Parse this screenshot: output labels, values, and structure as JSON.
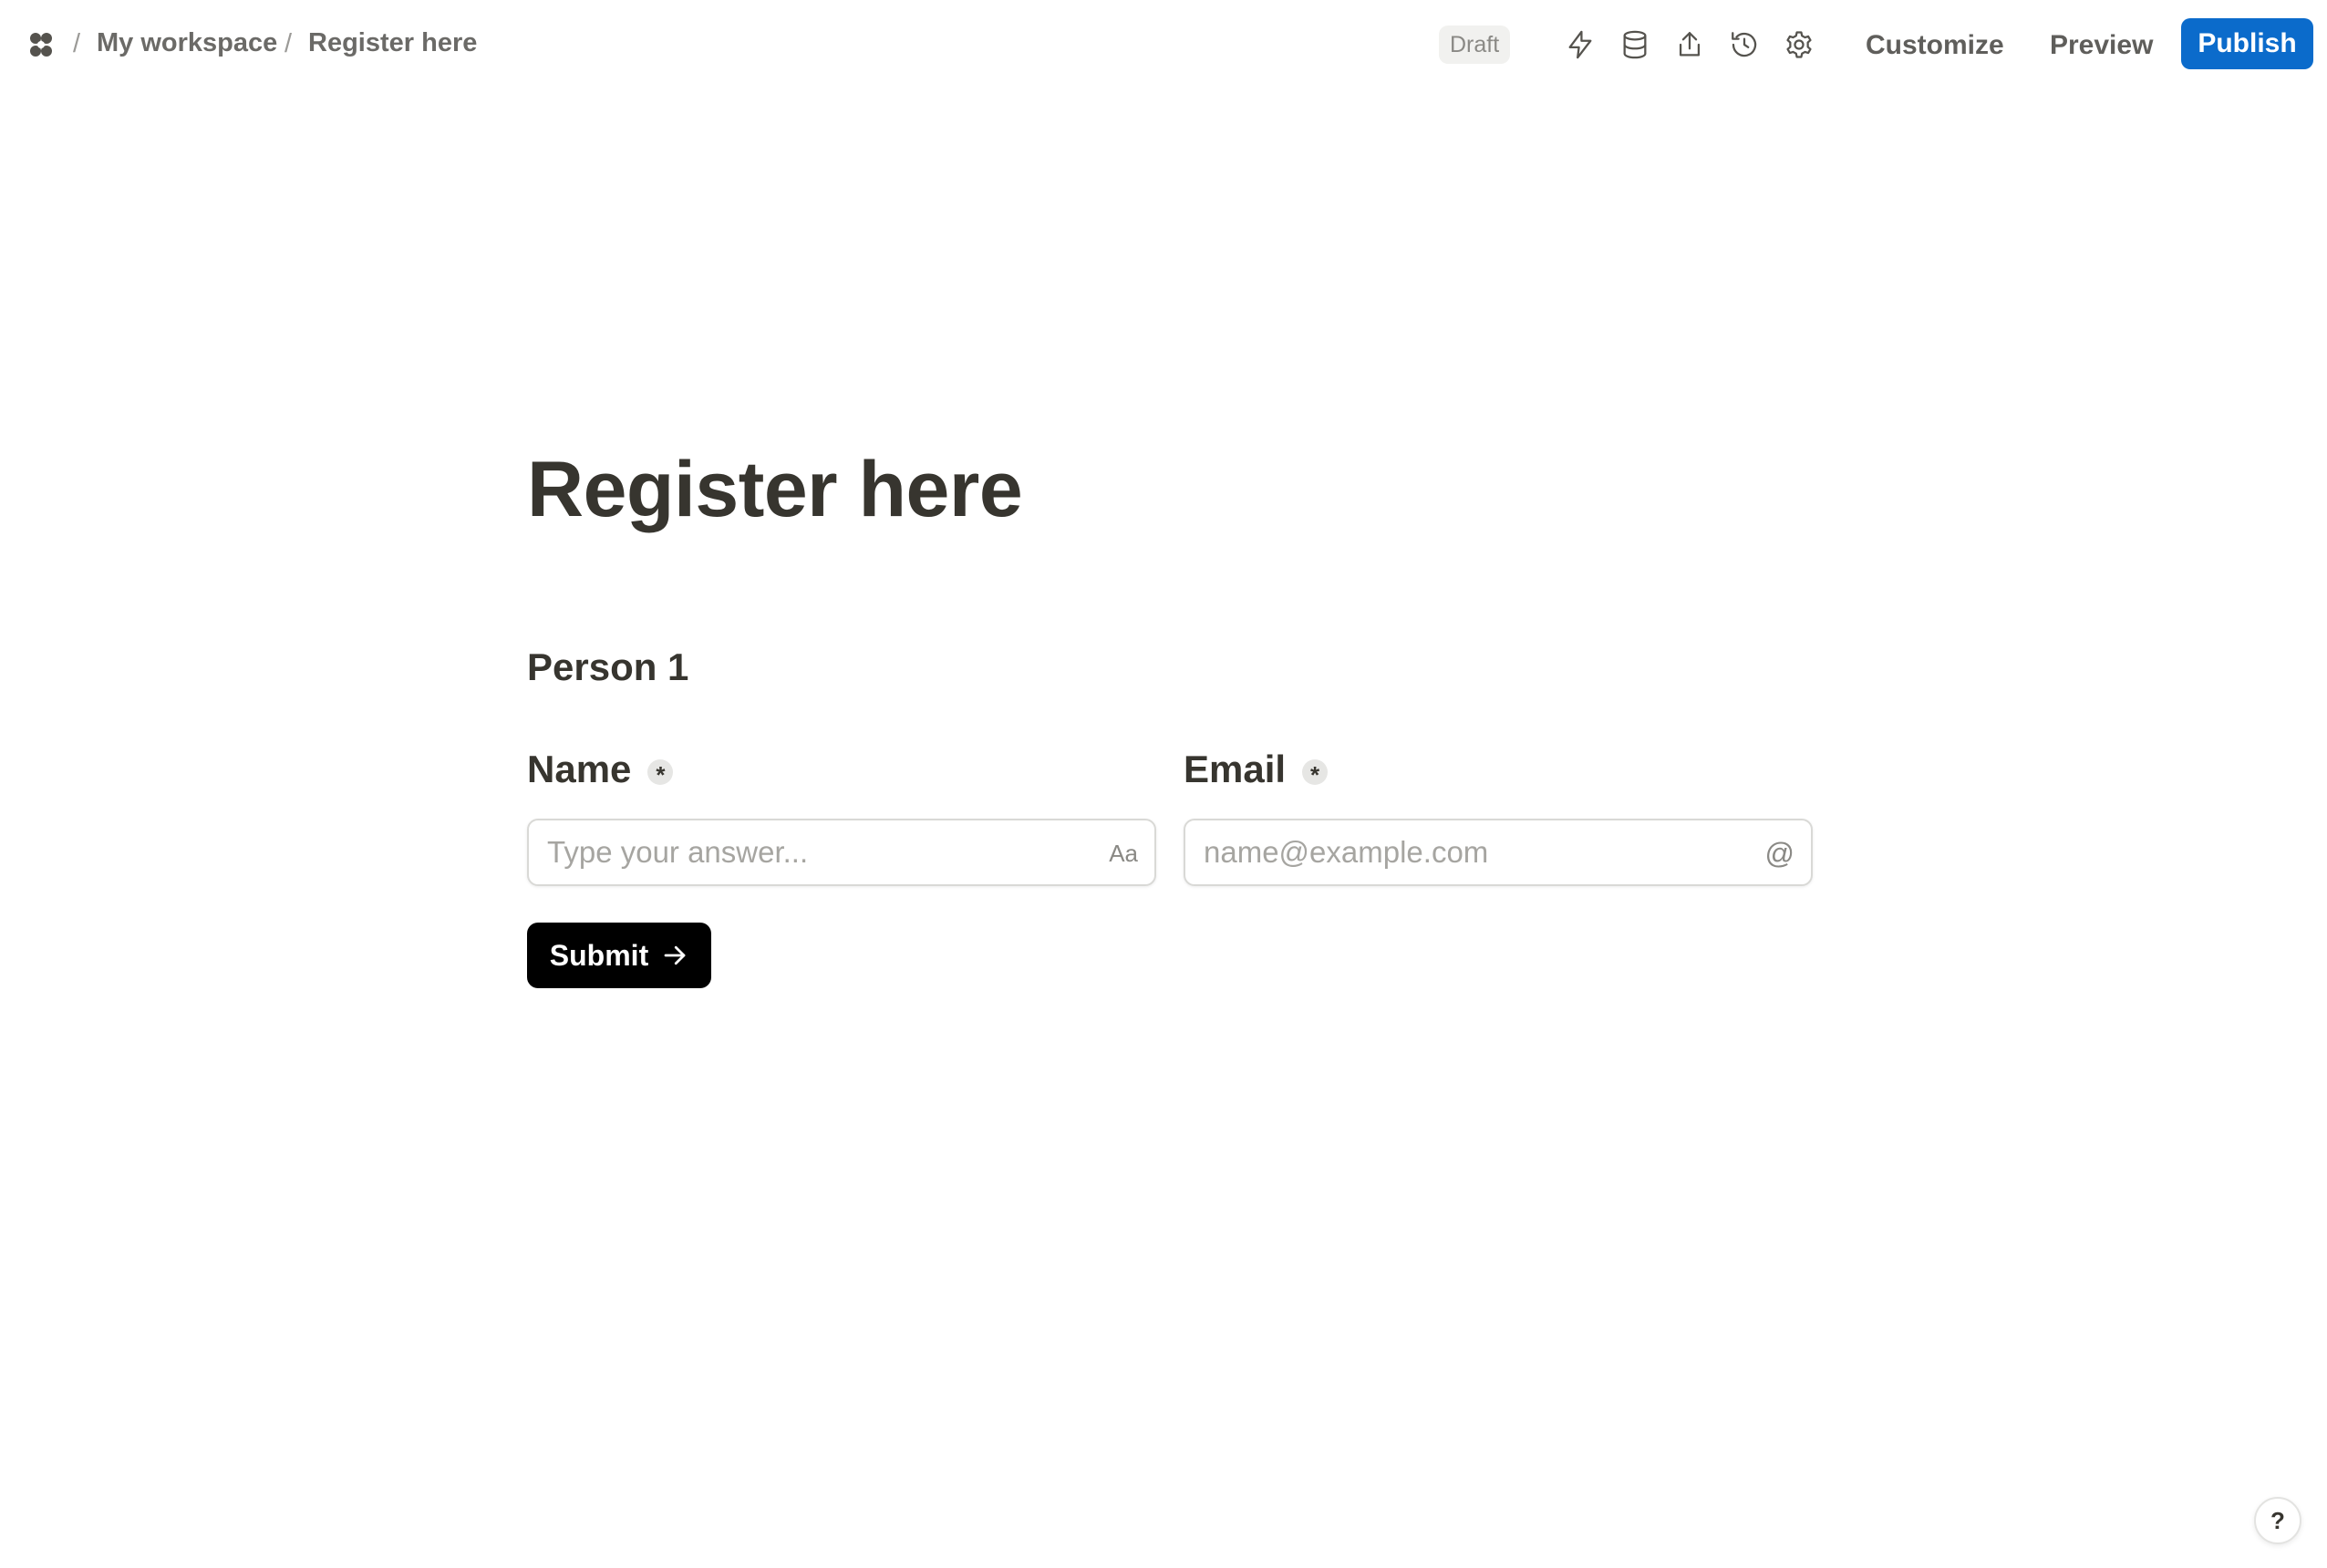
{
  "breadcrumb": {
    "separator": "/",
    "items": [
      "My workspace",
      "Register here"
    ]
  },
  "toolbar": {
    "status": "Draft",
    "icons": [
      "lightning-icon",
      "database-icon",
      "share-icon",
      "history-icon",
      "settings-icon"
    ],
    "customize_label": "Customize",
    "preview_label": "Preview",
    "publish_label": "Publish"
  },
  "form": {
    "title": "Register here",
    "section_title": "Person 1",
    "fields": [
      {
        "label": "Name",
        "required_mark": "*",
        "placeholder": "Type your answer...",
        "value": "",
        "icon_text": "Aa"
      },
      {
        "label": "Email",
        "required_mark": "*",
        "placeholder": "name@example.com",
        "value": "",
        "icon_text": "@"
      }
    ],
    "submit_label": "Submit"
  },
  "help": {
    "label": "?"
  },
  "colors": {
    "accent": "#0b6bcb",
    "text": "#37352f",
    "submit_bg": "#000000"
  }
}
